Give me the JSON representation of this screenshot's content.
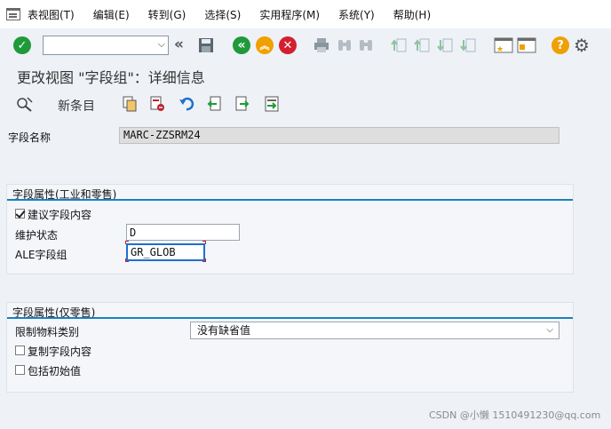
{
  "menu": {
    "items": [
      "表视图(T)",
      "编辑(E)",
      "转到(G)",
      "选择(S)",
      "实用程序(M)",
      "系统(Y)",
      "帮助(H)"
    ]
  },
  "toolbar": {
    "command_value": "",
    "icons": [
      "enter-icon",
      "command-dropdown-icon",
      "collapse-icon",
      "save-icon",
      "back-icon",
      "exit-icon",
      "cancel-icon",
      "print-icon",
      "find-icon",
      "find-next-icon",
      "first-page-icon",
      "previous-page-icon",
      "next-page-icon",
      "last-page-icon",
      "create-session-icon",
      "generate-shortcut-icon",
      "help-icon",
      "customize-layout-icon"
    ]
  },
  "page": {
    "title": "更改视图 \"字段组\"：详细信息"
  },
  "app_toolbar": {
    "new_entries_label": "新条目"
  },
  "fields": {
    "field_name_label": "字段名称",
    "field_name_value": "MARC-ZZSRM24"
  },
  "group1": {
    "title": "字段属性(工业和零售)",
    "propose_label": "建议字段内容",
    "propose_checked": true,
    "maint_status_label": "维护状态",
    "maint_status_value": "D",
    "ale_label": "ALE字段组",
    "ale_value": "GR_GLOB"
  },
  "group2": {
    "title": "字段属性(仅零售)",
    "material_type_label": "限制物料类别",
    "material_type_value": "没有缺省值",
    "copy_label": "复制字段内容",
    "copy_checked": false,
    "initial_label": "包括初始值",
    "initial_checked": false
  },
  "watermark": "CSDN @小懒 1510491230@qq.com",
  "colors": {
    "accent": "#1a7fc2",
    "enter_green": "#1f9a3a",
    "back_green": "#1f9a3a",
    "exit_orange": "#f0a000",
    "cancel_red": "#d3202f",
    "help_yellow": "#f0a000"
  }
}
